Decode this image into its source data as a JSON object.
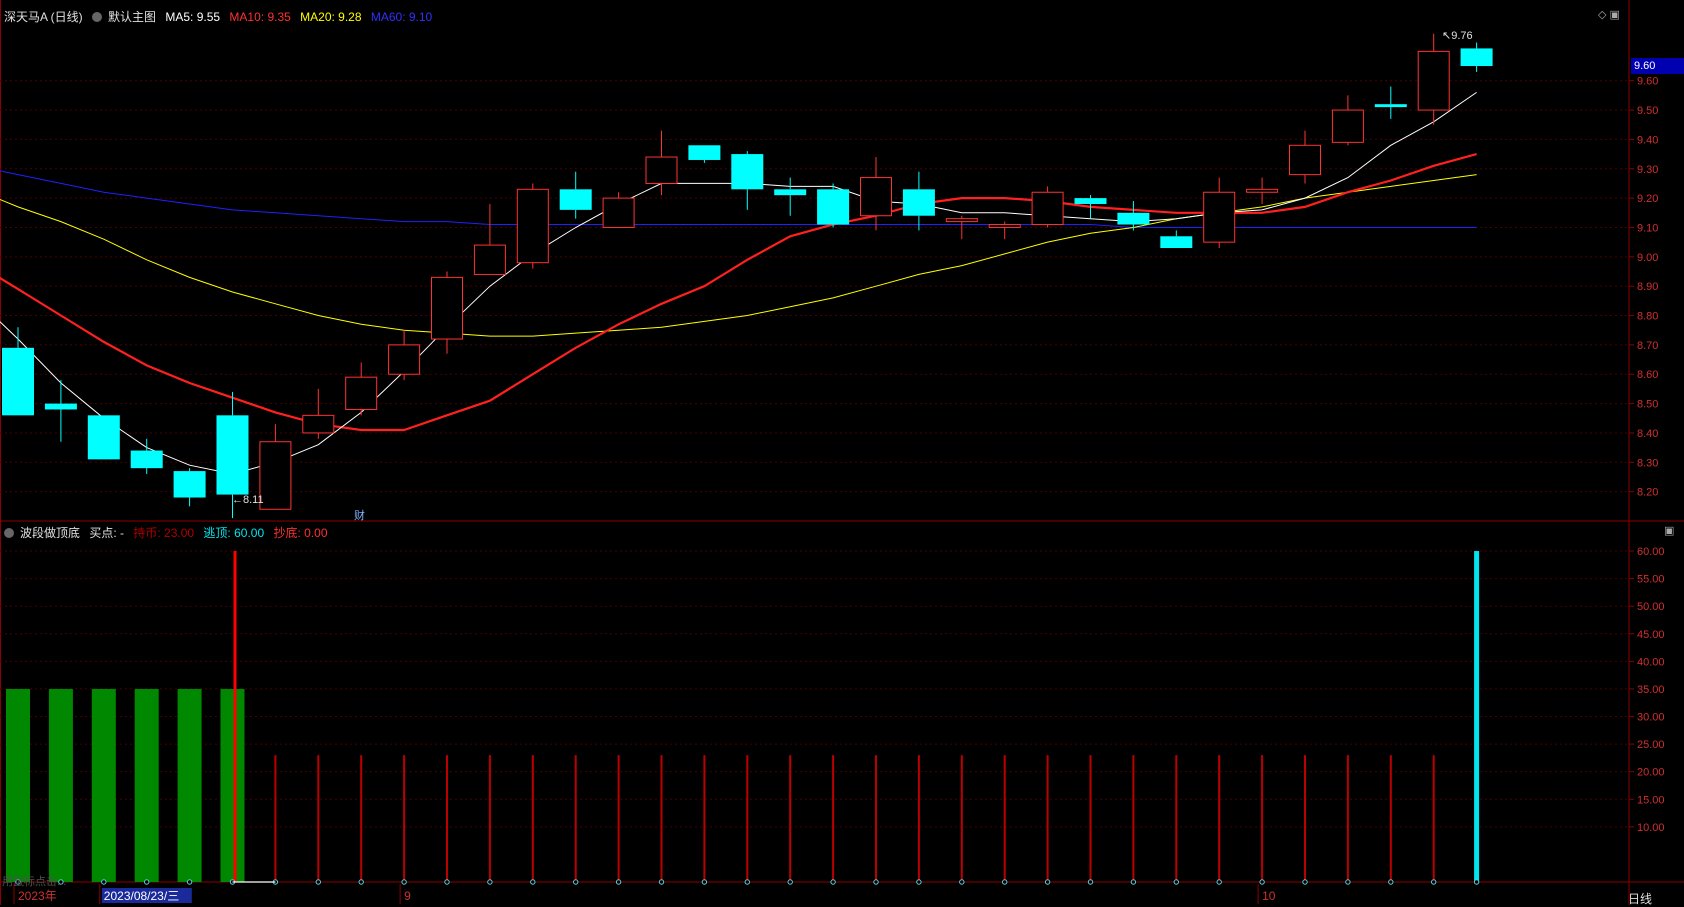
{
  "main_header": {
    "symbol": "深天马A (日线)",
    "template": "默认主图",
    "ma5_label": "MA5: 9.55",
    "ma10_label": "MA10: 9.35",
    "ma20_label": "MA20: 9.28",
    "ma60_label": "MA60: 9.10"
  },
  "sub_header": {
    "name": "波段做顶底",
    "buy_label": "买点: -",
    "hold_label": "持币: 23.00",
    "escape_label": "逃顶: 60.00",
    "bottom_label": "抄底: 0.00"
  },
  "colors": {
    "up": "#ff3232",
    "down": "#00ffff",
    "ma5": "#ffffff",
    "ma10": "#ff2020",
    "ma20": "#ffff00",
    "ma60": "#2020ff",
    "grid": "#4a0000",
    "axis": "#8b0000",
    "escape": "#00e5ee",
    "hold": "#bb0000",
    "bottom": "#008800"
  },
  "price_badge": "9.60",
  "high_marker": "9.76",
  "low_marker": "8.11",
  "fin_marker": "财",
  "watermark": "用鼠标点击...",
  "period_button": "日线",
  "chart_data": [
    {
      "type": "candlestick",
      "title": "深天马A (日线)",
      "ylim": [
        8.1,
        9.8
      ],
      "y_ticks": [
        8.2,
        8.3,
        8.4,
        8.5,
        8.6,
        8.7,
        8.8,
        8.9,
        9.0,
        9.1,
        9.2,
        9.3,
        9.4,
        9.5,
        9.6
      ],
      "y_tick_labels": [
        "8.20",
        "8.30",
        "8.40",
        "8.50",
        "8.60",
        "8.70",
        "8.80",
        "8.90",
        "9.00",
        "9.10",
        "9.20",
        "9.30",
        "9.40",
        "9.50",
        "9.60"
      ],
      "candles": [
        {
          "o": 8.69,
          "h": 8.76,
          "l": 8.46,
          "c": 8.46
        },
        {
          "o": 8.5,
          "h": 8.58,
          "l": 8.37,
          "c": 8.48
        },
        {
          "o": 8.46,
          "h": 8.46,
          "l": 8.31,
          "c": 8.31
        },
        {
          "o": 8.34,
          "h": 8.38,
          "l": 8.26,
          "c": 8.28
        },
        {
          "o": 8.27,
          "h": 8.28,
          "l": 8.15,
          "c": 8.18
        },
        {
          "o": 8.46,
          "h": 8.54,
          "l": 8.11,
          "c": 8.19
        },
        {
          "o": 8.14,
          "h": 8.43,
          "l": 8.14,
          "c": 8.37
        },
        {
          "o": 8.4,
          "h": 8.55,
          "l": 8.38,
          "c": 8.46
        },
        {
          "o": 8.48,
          "h": 8.64,
          "l": 8.46,
          "c": 8.59
        },
        {
          "o": 8.6,
          "h": 8.75,
          "l": 8.58,
          "c": 8.7
        },
        {
          "o": 8.72,
          "h": 8.95,
          "l": 8.67,
          "c": 8.93
        },
        {
          "o": 8.94,
          "h": 9.18,
          "l": 8.94,
          "c": 9.04
        },
        {
          "o": 8.98,
          "h": 9.25,
          "l": 8.96,
          "c": 9.23
        },
        {
          "o": 9.23,
          "h": 9.29,
          "l": 9.13,
          "c": 9.16
        },
        {
          "o": 9.1,
          "h": 9.22,
          "l": 9.1,
          "c": 9.2
        },
        {
          "o": 9.25,
          "h": 9.43,
          "l": 9.21,
          "c": 9.34
        },
        {
          "o": 9.38,
          "h": 9.38,
          "l": 9.32,
          "c": 9.33
        },
        {
          "o": 9.35,
          "h": 9.36,
          "l": 9.16,
          "c": 9.23
        },
        {
          "o": 9.23,
          "h": 9.27,
          "l": 9.14,
          "c": 9.21
        },
        {
          "o": 9.23,
          "h": 9.25,
          "l": 9.1,
          "c": 9.11
        },
        {
          "o": 9.14,
          "h": 9.34,
          "l": 9.09,
          "c": 9.27
        },
        {
          "o": 9.23,
          "h": 9.29,
          "l": 9.09,
          "c": 9.14
        },
        {
          "o": 9.12,
          "h": 9.14,
          "l": 9.06,
          "c": 9.13
        },
        {
          "o": 9.1,
          "h": 9.12,
          "l": 9.06,
          "c": 9.11
        },
        {
          "o": 9.11,
          "h": 9.24,
          "l": 9.1,
          "c": 9.22
        },
        {
          "o": 9.2,
          "h": 9.21,
          "l": 9.13,
          "c": 9.18
        },
        {
          "o": 9.15,
          "h": 9.19,
          "l": 9.09,
          "c": 9.11
        },
        {
          "o": 9.07,
          "h": 9.09,
          "l": 9.03,
          "c": 9.03
        },
        {
          "o": 9.05,
          "h": 9.27,
          "l": 9.03,
          "c": 9.22
        },
        {
          "o": 9.22,
          "h": 9.27,
          "l": 9.18,
          "c": 9.23
        },
        {
          "o": 9.28,
          "h": 9.43,
          "l": 9.25,
          "c": 9.38
        },
        {
          "o": 9.39,
          "h": 9.55,
          "l": 9.38,
          "c": 9.5
        },
        {
          "o": 9.52,
          "h": 9.58,
          "l": 9.47,
          "c": 9.51
        },
        {
          "o": 9.5,
          "h": 9.76,
          "l": 9.45,
          "c": 9.7
        },
        {
          "o": 9.71,
          "h": 9.73,
          "l": 9.63,
          "c": 9.65
        }
      ],
      "ma5": [
        8.86,
        8.72,
        8.57,
        8.45,
        8.35,
        8.29,
        8.26,
        8.3,
        8.36,
        8.47,
        8.61,
        8.76,
        8.9,
        9.01,
        9.1,
        9.18,
        9.25,
        9.25,
        9.25,
        9.24,
        9.24,
        9.19,
        9.18,
        9.15,
        9.15,
        9.14,
        9.13,
        9.12,
        9.13,
        9.15,
        9.16,
        9.2,
        9.27,
        9.38,
        9.46,
        9.56
      ],
      "ma10": [
        9.07,
        8.98,
        8.89,
        8.8,
        8.71,
        8.63,
        8.57,
        8.52,
        8.47,
        8.43,
        8.41,
        8.41,
        8.46,
        8.51,
        8.6,
        8.69,
        8.77,
        8.84,
        8.9,
        8.99,
        9.07,
        9.11,
        9.14,
        9.18,
        9.2,
        9.2,
        9.19,
        9.17,
        9.16,
        9.15,
        9.15,
        9.15,
        9.17,
        9.22,
        9.26,
        9.31,
        9.35
      ],
      "ma20": [
        9.23,
        9.17,
        9.12,
        9.06,
        8.99,
        8.93,
        8.88,
        8.84,
        8.8,
        8.77,
        8.75,
        8.74,
        8.73,
        8.73,
        8.74,
        8.75,
        8.76,
        8.78,
        8.8,
        8.83,
        8.86,
        8.9,
        8.94,
        8.97,
        9.01,
        9.05,
        9.08,
        9.1,
        9.13,
        9.15,
        9.17,
        9.2,
        9.22,
        9.24,
        9.26,
        9.28
      ],
      "ma60": [
        9.31,
        9.28,
        9.25,
        9.22,
        9.2,
        9.18,
        9.16,
        9.15,
        9.14,
        9.13,
        9.12,
        9.12,
        9.11,
        9.11,
        9.11,
        9.11,
        9.11,
        9.11,
        9.11,
        9.11,
        9.11,
        9.11,
        9.11,
        9.11,
        9.11,
        9.11,
        9.11,
        9.1,
        9.1,
        9.1,
        9.1,
        9.1,
        9.1,
        9.1,
        9.1,
        9.1
      ]
    },
    {
      "type": "bar",
      "title": "波段做顶底",
      "ylim": [
        0,
        62
      ],
      "y_ticks": [
        10,
        15,
        20,
        25,
        30,
        35,
        40,
        45,
        50,
        55,
        60
      ],
      "y_tick_labels": [
        "10.00",
        "15.00",
        "20.00",
        "25.00",
        "30.00",
        "35.00",
        "40.00",
        "45.00",
        "50.00",
        "55.00",
        "60.00"
      ],
      "series": [
        {
          "name": "持币",
          "values": [
            0,
            0,
            0,
            0,
            0,
            0,
            23,
            23,
            23,
            23,
            23,
            23,
            23,
            23,
            23,
            23,
            23,
            23,
            23,
            23,
            23,
            23,
            23,
            23,
            23,
            23,
            23,
            23,
            23,
            23,
            23,
            23,
            23,
            23,
            0
          ]
        },
        {
          "name": "逃顶",
          "values": [
            0,
            0,
            0,
            0,
            0,
            0,
            0,
            0,
            0,
            0,
            0,
            0,
            0,
            0,
            0,
            0,
            0,
            0,
            0,
            0,
            0,
            0,
            0,
            0,
            0,
            0,
            0,
            0,
            0,
            0,
            0,
            0,
            0,
            0,
            60
          ]
        },
        {
          "name": "抄底",
          "values": [
            35,
            35,
            35,
            35,
            35,
            35,
            0,
            0,
            0,
            0,
            0,
            0,
            0,
            0,
            0,
            0,
            0,
            0,
            0,
            0,
            0,
            0,
            0,
            0,
            0,
            0,
            0,
            0,
            0,
            0,
            0,
            0,
            0,
            0,
            0
          ]
        },
        {
          "name": "signal",
          "values": [
            0,
            0,
            0,
            0,
            0,
            60,
            0,
            0,
            0,
            0,
            0,
            0,
            0,
            0,
            0,
            0,
            0,
            0,
            0,
            0,
            0,
            0,
            0,
            0,
            0,
            0,
            0,
            0,
            0,
            0,
            0,
            0,
            0,
            0,
            0
          ]
        }
      ]
    }
  ],
  "x_axis": {
    "labels": [
      {
        "idx": 0,
        "text": "2023年"
      },
      {
        "idx": 2,
        "text": "2023/08/23/三"
      },
      {
        "idx": 9,
        "text": "9"
      },
      {
        "idx": 29,
        "text": "10"
      }
    ]
  }
}
